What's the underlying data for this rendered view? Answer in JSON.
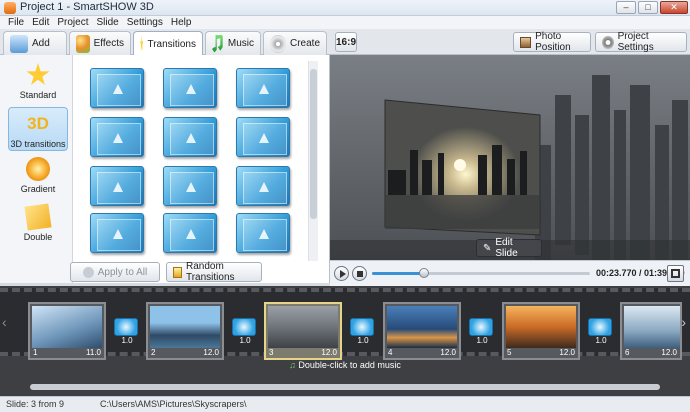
{
  "window": {
    "title": "Project 1 - SmartSHOW 3D"
  },
  "menu": [
    "File",
    "Edit",
    "Project",
    "Slide",
    "Settings",
    "Help"
  ],
  "tabs": [
    {
      "label": "Add",
      "icon": "add-media-icon"
    },
    {
      "label": "Effects",
      "icon": "palette-icon"
    },
    {
      "label": "Transitions",
      "icon": "star-icon"
    },
    {
      "label": "Music",
      "icon": "music-note-icon"
    },
    {
      "label": "Create",
      "icon": "disc-icon"
    }
  ],
  "right_toolbar": {
    "ratio": "16:9",
    "photo_position": "Photo Position",
    "project_settings": "Project Settings"
  },
  "categories": [
    {
      "label": "Standard",
      "icon": "star-icon"
    },
    {
      "label": "3D transitions",
      "icon": "3d-icon",
      "badge": "3D"
    },
    {
      "label": "Gradient",
      "icon": "gradient-icon"
    },
    {
      "label": "Double",
      "icon": "double-icon"
    }
  ],
  "transitions_count": 12,
  "bottom_buttons": {
    "apply_all": "Apply to All",
    "random": "Random Transitions"
  },
  "preview": {
    "edit_slide": "Edit Slide"
  },
  "playback": {
    "time": "00:23.770 / 01:39.000",
    "progress": 0.24
  },
  "slides": [
    {
      "num": "1",
      "dur": "11.0",
      "trans": "1.0"
    },
    {
      "num": "2",
      "dur": "12.0",
      "trans": "1.0"
    },
    {
      "num": "3",
      "dur": "12.0",
      "trans": "1.0"
    },
    {
      "num": "4",
      "dur": "12.0",
      "trans": "1.0"
    },
    {
      "num": "5",
      "dur": "12.0",
      "trans": "1.0"
    },
    {
      "num": "6",
      "dur": "12.0",
      "trans": ""
    }
  ],
  "music_hint": "Double-click to add music",
  "status": {
    "slide": "Slide: 3 from 9",
    "path": "C:\\Users\\AMS\\Pictures\\Skyscrapers\\"
  }
}
